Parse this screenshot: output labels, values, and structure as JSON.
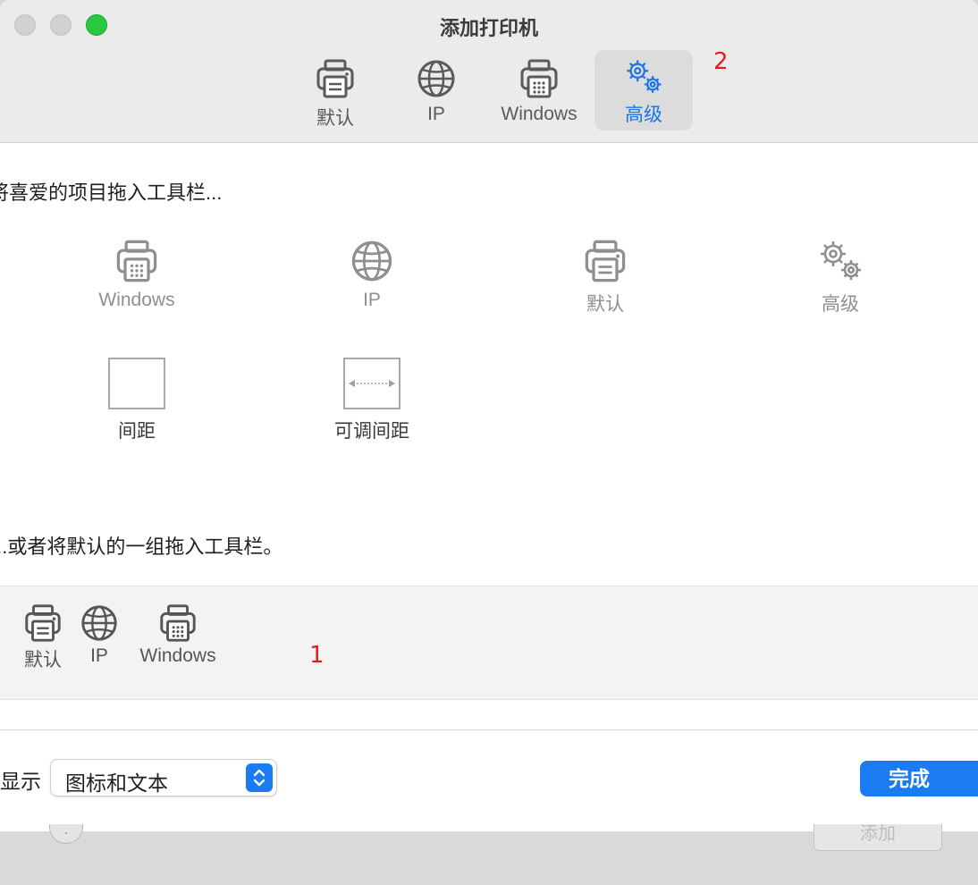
{
  "window": {
    "title": "添加打印机"
  },
  "toolbar": {
    "items": [
      {
        "label": "默认",
        "icon": "printer-icon",
        "active": false
      },
      {
        "label": "IP",
        "icon": "globe-icon",
        "active": false
      },
      {
        "label": "Windows",
        "icon": "fax-printer-icon",
        "active": false
      },
      {
        "label": "高级",
        "icon": "gears-icon",
        "active": true
      }
    ],
    "annotation": "2"
  },
  "customize_sheet": {
    "palette_heading": "将喜爱的项目拖入工具栏...",
    "palette_items": [
      {
        "label": "Windows",
        "icon": "fax-printer-icon"
      },
      {
        "label": "IP",
        "icon": "globe-icon"
      },
      {
        "label": "默认",
        "icon": "printer-icon"
      },
      {
        "label": "高级",
        "icon": "gears-icon"
      },
      {
        "label": "间距",
        "icon": "space-box"
      },
      {
        "label": "可调间距",
        "icon": "flexible-space-box"
      }
    ],
    "default_heading": "...或者将默认的一组拖入工具栏。",
    "default_set": [
      {
        "label": "默认",
        "icon": "printer-icon"
      },
      {
        "label": "IP",
        "icon": "globe-icon"
      },
      {
        "label": "Windows",
        "icon": "fax-printer-icon"
      }
    ],
    "default_annotation": "1",
    "show_label": "显示",
    "show_select_value": "图标和文本",
    "done_label": "完成"
  },
  "background_window": {
    "add_button_label": "添加"
  },
  "colors": {
    "accent": "#1a7bf2",
    "annotation": "#e0201b",
    "traffic_zoom": "#28c840"
  }
}
